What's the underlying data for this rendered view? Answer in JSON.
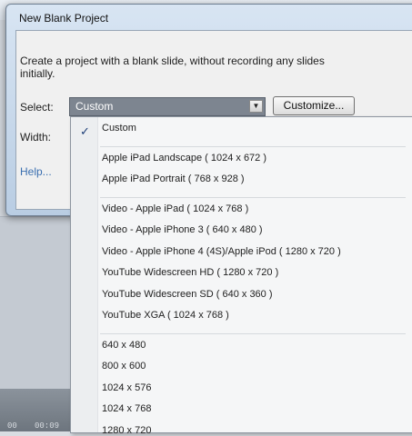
{
  "dialog": {
    "title": "New Blank Project",
    "description": "Create a project with a blank slide, without recording any slides initially.",
    "select_label": "Select:",
    "select_value": "Custom",
    "customize_label": "Customize...",
    "width_label": "Width:",
    "help_label": "Help..."
  },
  "dropdown": {
    "groups": [
      [
        "Custom"
      ],
      [
        "Apple iPad Landscape ( 1024 x 672 )",
        "Apple iPad Portrait ( 768 x 928 )"
      ],
      [
        "Video - Apple iPad ( 1024 x 768 )",
        "Video - Apple iPhone 3 ( 640 x 480 )",
        "Video - Apple iPhone 4 (4S)/Apple iPod ( 1280 x 720 )",
        "YouTube Widescreen HD ( 1280 x 720 )",
        "YouTube Widescreen SD ( 640 x 360 )",
        "YouTube XGA ( 1024 x 768 )"
      ],
      [
        "640 x 480",
        "800 x 600",
        "1024 x 576",
        "1024 x 768",
        "1280 x 720"
      ]
    ],
    "checked": "Custom"
  },
  "background": {
    "timeline_text_left": "00",
    "timeline_text_right": "00:09"
  },
  "colors": {
    "select_bg": "#7d8590",
    "link": "#3b6fb0",
    "check": "#1e3f78"
  }
}
